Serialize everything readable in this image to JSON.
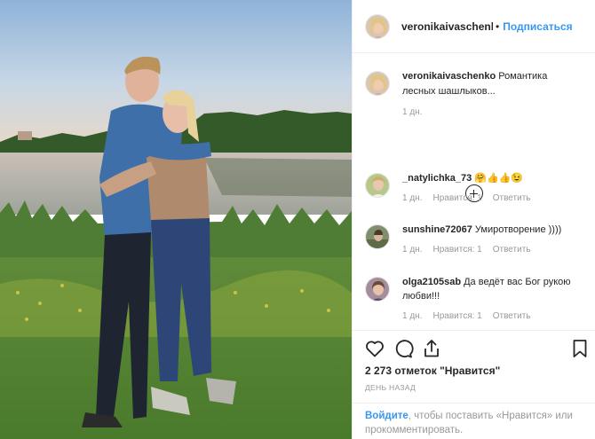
{
  "post": {
    "author": "veronikaivaschenko",
    "author_truncated": "veronikaivaschenkc",
    "dot": "•",
    "follow_label": "Подписаться",
    "photo_icon": "photo-of-couple-by-lake"
  },
  "comments": [
    {
      "user": "veronikaivaschenko",
      "text": " Романтика лесных шашлыков...",
      "time": "1 дн.",
      "likes": "",
      "reply": ""
    },
    {
      "user": "_natylichka_73",
      "text": " 🤗👍👍😉",
      "time": "1 дн.",
      "likes": "Нравится: 1",
      "reply": "Ответить"
    },
    {
      "user": "sunshine72067",
      "text": " Умиротворение ))))",
      "time": "1 дн.",
      "likes": "Нравится: 1",
      "reply": "Ответить"
    },
    {
      "user": "olga2105sab",
      "text": " Да ведёт вас Бог рукою любви!!!",
      "time": "1 дн.",
      "likes": "Нравится: 1",
      "reply": "Ответить"
    }
  ],
  "actions": {
    "like_icon": "heart-icon",
    "comment_icon": "comment-icon",
    "share_icon": "share-icon",
    "save_icon": "bookmark-icon",
    "likes_count": "2 273 отметок",
    "likes_label": "\"Нравится\"",
    "date": "День назад"
  },
  "login": {
    "link": "Войдите",
    "text": ", чтобы поставить «Нравится» или прокомментировать."
  },
  "colors": {
    "accent": "#3897f0",
    "text": "#262626",
    "muted": "#999999",
    "border": "#efefef"
  }
}
